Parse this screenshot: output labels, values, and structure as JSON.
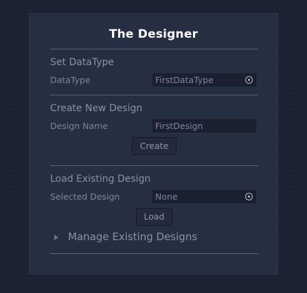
{
  "window": {
    "title": "The Designer"
  },
  "set_datatype": {
    "header": "Set DataType",
    "field_label": "DataType",
    "field_value": "FirstDataType",
    "picker_icon": "object-picker-icon"
  },
  "create_design": {
    "header": "Create New Design",
    "field_label": "Design Name",
    "field_value": "FirstDesign",
    "button_label": "Create"
  },
  "load_design": {
    "header": "Load Existing Design",
    "field_label": "Selected Design",
    "field_value": "None",
    "picker_icon": "object-picker-icon",
    "button_label": "Load"
  },
  "manage": {
    "foldout_label": "Manage Existing Designs",
    "expanded": false
  },
  "colors": {
    "background": "#1c2232",
    "panel": "#262e42",
    "field": "#1a2030",
    "title_text": "#ffffff",
    "muted_text": "#8a92a4"
  }
}
